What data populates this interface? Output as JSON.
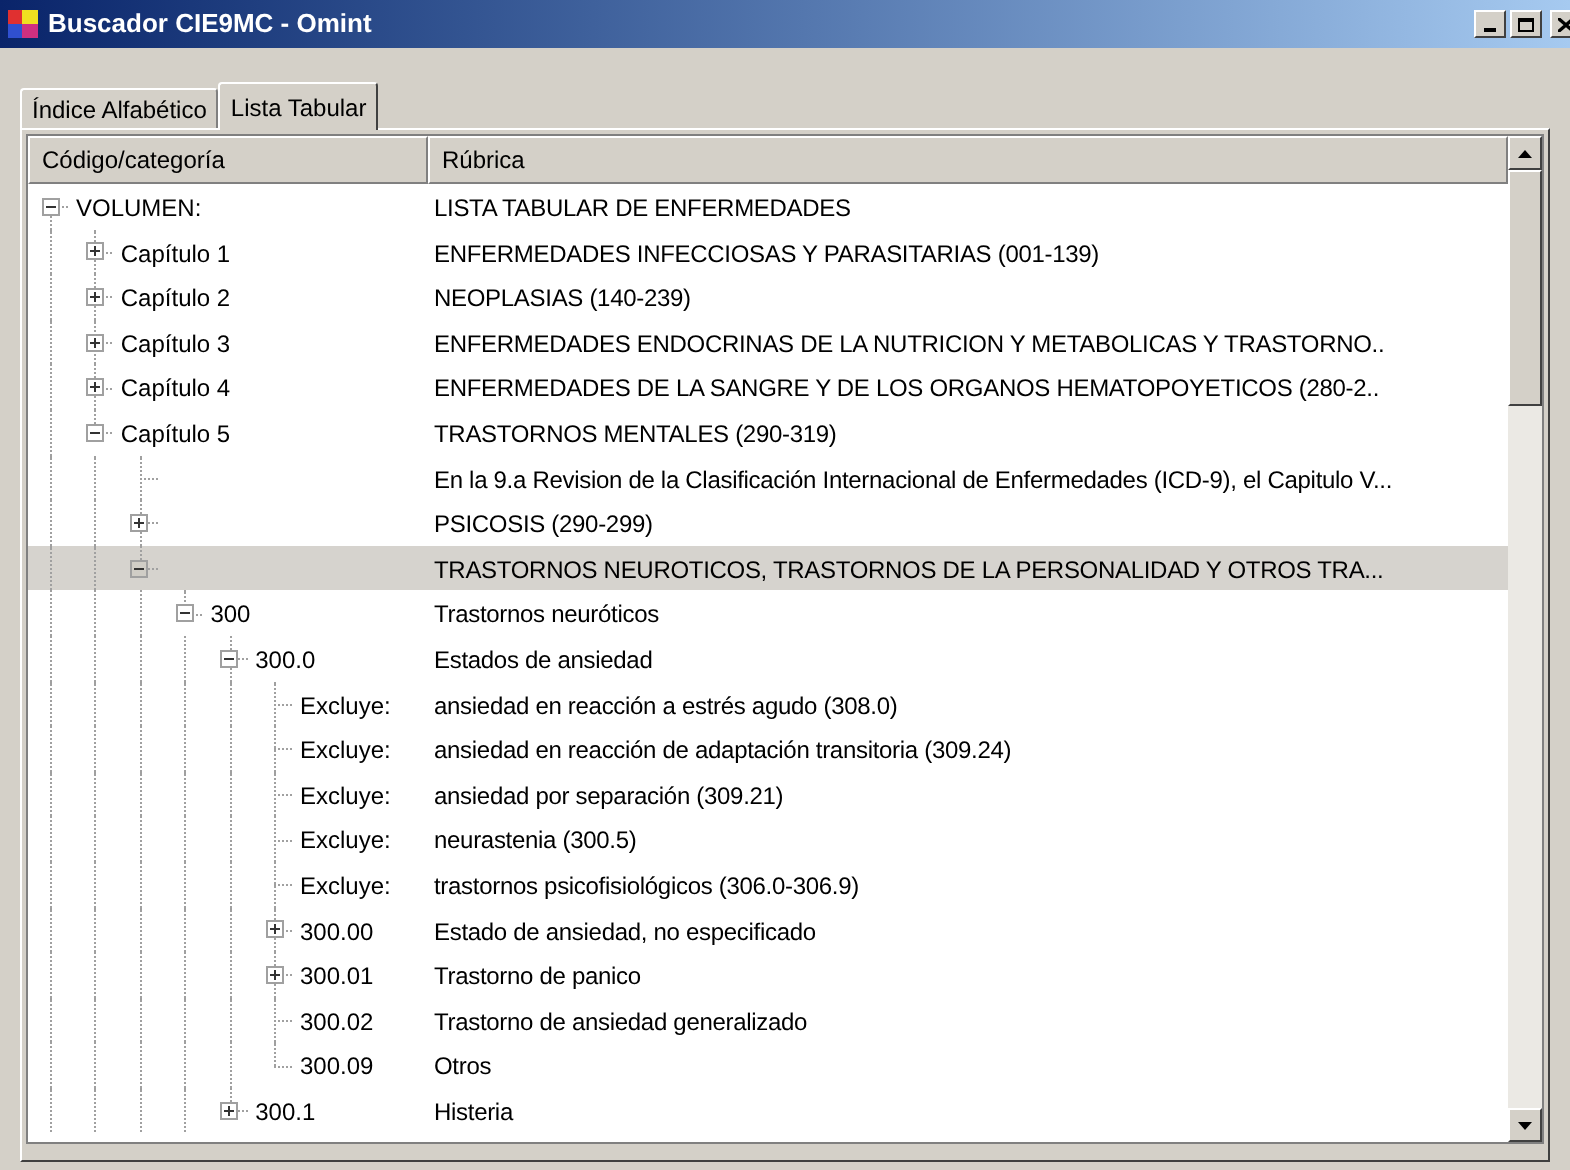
{
  "window": {
    "title": "Buscador CIE9MC - Omint"
  },
  "tabs": [
    {
      "label": "Índice Alfabético",
      "selected": false
    },
    {
      "label": "Lista Tabular",
      "selected": true
    }
  ],
  "columns": [
    "Código/categoría",
    "Rúbrica"
  ],
  "tree": [
    {
      "code": "VOLUMEN:",
      "text": "LISTA TABULAR DE ENFERMEDADES",
      "kind": "node",
      "expanded": true,
      "selected": false,
      "children": [
        {
          "code": "Capítulo 1",
          "text": "ENFERMEDADES INFECCIOSAS Y PARASITARIAS (001-139)",
          "kind": "node",
          "expanded": false,
          "selected": false
        },
        {
          "code": "Capítulo 2",
          "text": "NEOPLASIAS (140-239)",
          "kind": "node",
          "expanded": false,
          "selected": false
        },
        {
          "code": "Capítulo 3",
          "text": "ENFERMEDADES ENDOCRINAS DE LA NUTRICION Y METABOLICAS Y TRASTORNO..",
          "kind": "node",
          "expanded": false,
          "selected": false
        },
        {
          "code": "Capítulo 4",
          "text": "ENFERMEDADES DE LA SANGRE Y DE LOS ORGANOS HEMATOPOYETICOS (280-2..",
          "kind": "node",
          "expanded": false,
          "selected": false
        },
        {
          "code": "Capítulo 5",
          "text": "TRASTORNOS MENTALES (290-319)",
          "kind": "node",
          "expanded": true,
          "selected": false,
          "children": [
            {
              "text": "En la 9.a Revision de la Clasificación Internacional de Enfermedades (ICD-9), el Capitulo V...",
              "kind": "leaf",
              "selected": false
            },
            {
              "text": "PSICOSIS (290-299)",
              "kind": "node",
              "expanded": false,
              "selected": false
            },
            {
              "text": "TRASTORNOS NEUROTICOS, TRASTORNOS DE LA PERSONALIDAD Y OTROS TRA...",
              "kind": "node",
              "expanded": true,
              "selected": true,
              "children": [
                {
                  "code": "300",
                  "text": "Trastornos neuróticos",
                  "kind": "node",
                  "expanded": true,
                  "selected": false,
                  "children": [
                    {
                      "code": "300.0",
                      "text": "Estados de ansiedad",
                      "kind": "node",
                      "expanded": true,
                      "selected": false,
                      "children": [
                        {
                          "code": "Excluye:",
                          "text": "ansiedad en reacción a estrés agudo (308.0)",
                          "kind": "leaf",
                          "selected": false
                        },
                        {
                          "code": "Excluye:",
                          "text": "ansiedad en reacción de adaptación transitoria (309.24)",
                          "kind": "leaf",
                          "selected": false
                        },
                        {
                          "code": "Excluye:",
                          "text": "ansiedad por separación (309.21)",
                          "kind": "leaf",
                          "selected": false
                        },
                        {
                          "code": "Excluye:",
                          "text": "neurastenia (300.5)",
                          "kind": "leaf",
                          "selected": false
                        },
                        {
                          "code": "Excluye:",
                          "text": "trastornos psicofisiológicos (306.0-306.9)",
                          "kind": "leaf",
                          "selected": false
                        },
                        {
                          "code": "300.00",
                          "text": "Estado de ansiedad, no especificado",
                          "kind": "node",
                          "expanded": false,
                          "selected": false
                        },
                        {
                          "code": "300.01",
                          "text": "Trastorno de panico",
                          "kind": "node",
                          "expanded": false,
                          "selected": false
                        },
                        {
                          "code": "300.02",
                          "text": "Trastorno de ansiedad generalizado",
                          "kind": "leaf",
                          "selected": false
                        },
                        {
                          "code": "300.09",
                          "text": "Otros",
                          "kind": "leaf",
                          "selected": false
                        }
                      ]
                    },
                    {
                      "code": "300.1",
                      "text": "Histeria",
                      "kind": "node",
                      "expanded": false,
                      "selected": false
                    }
                  ]
                }
              ]
            }
          ]
        }
      ]
    }
  ]
}
